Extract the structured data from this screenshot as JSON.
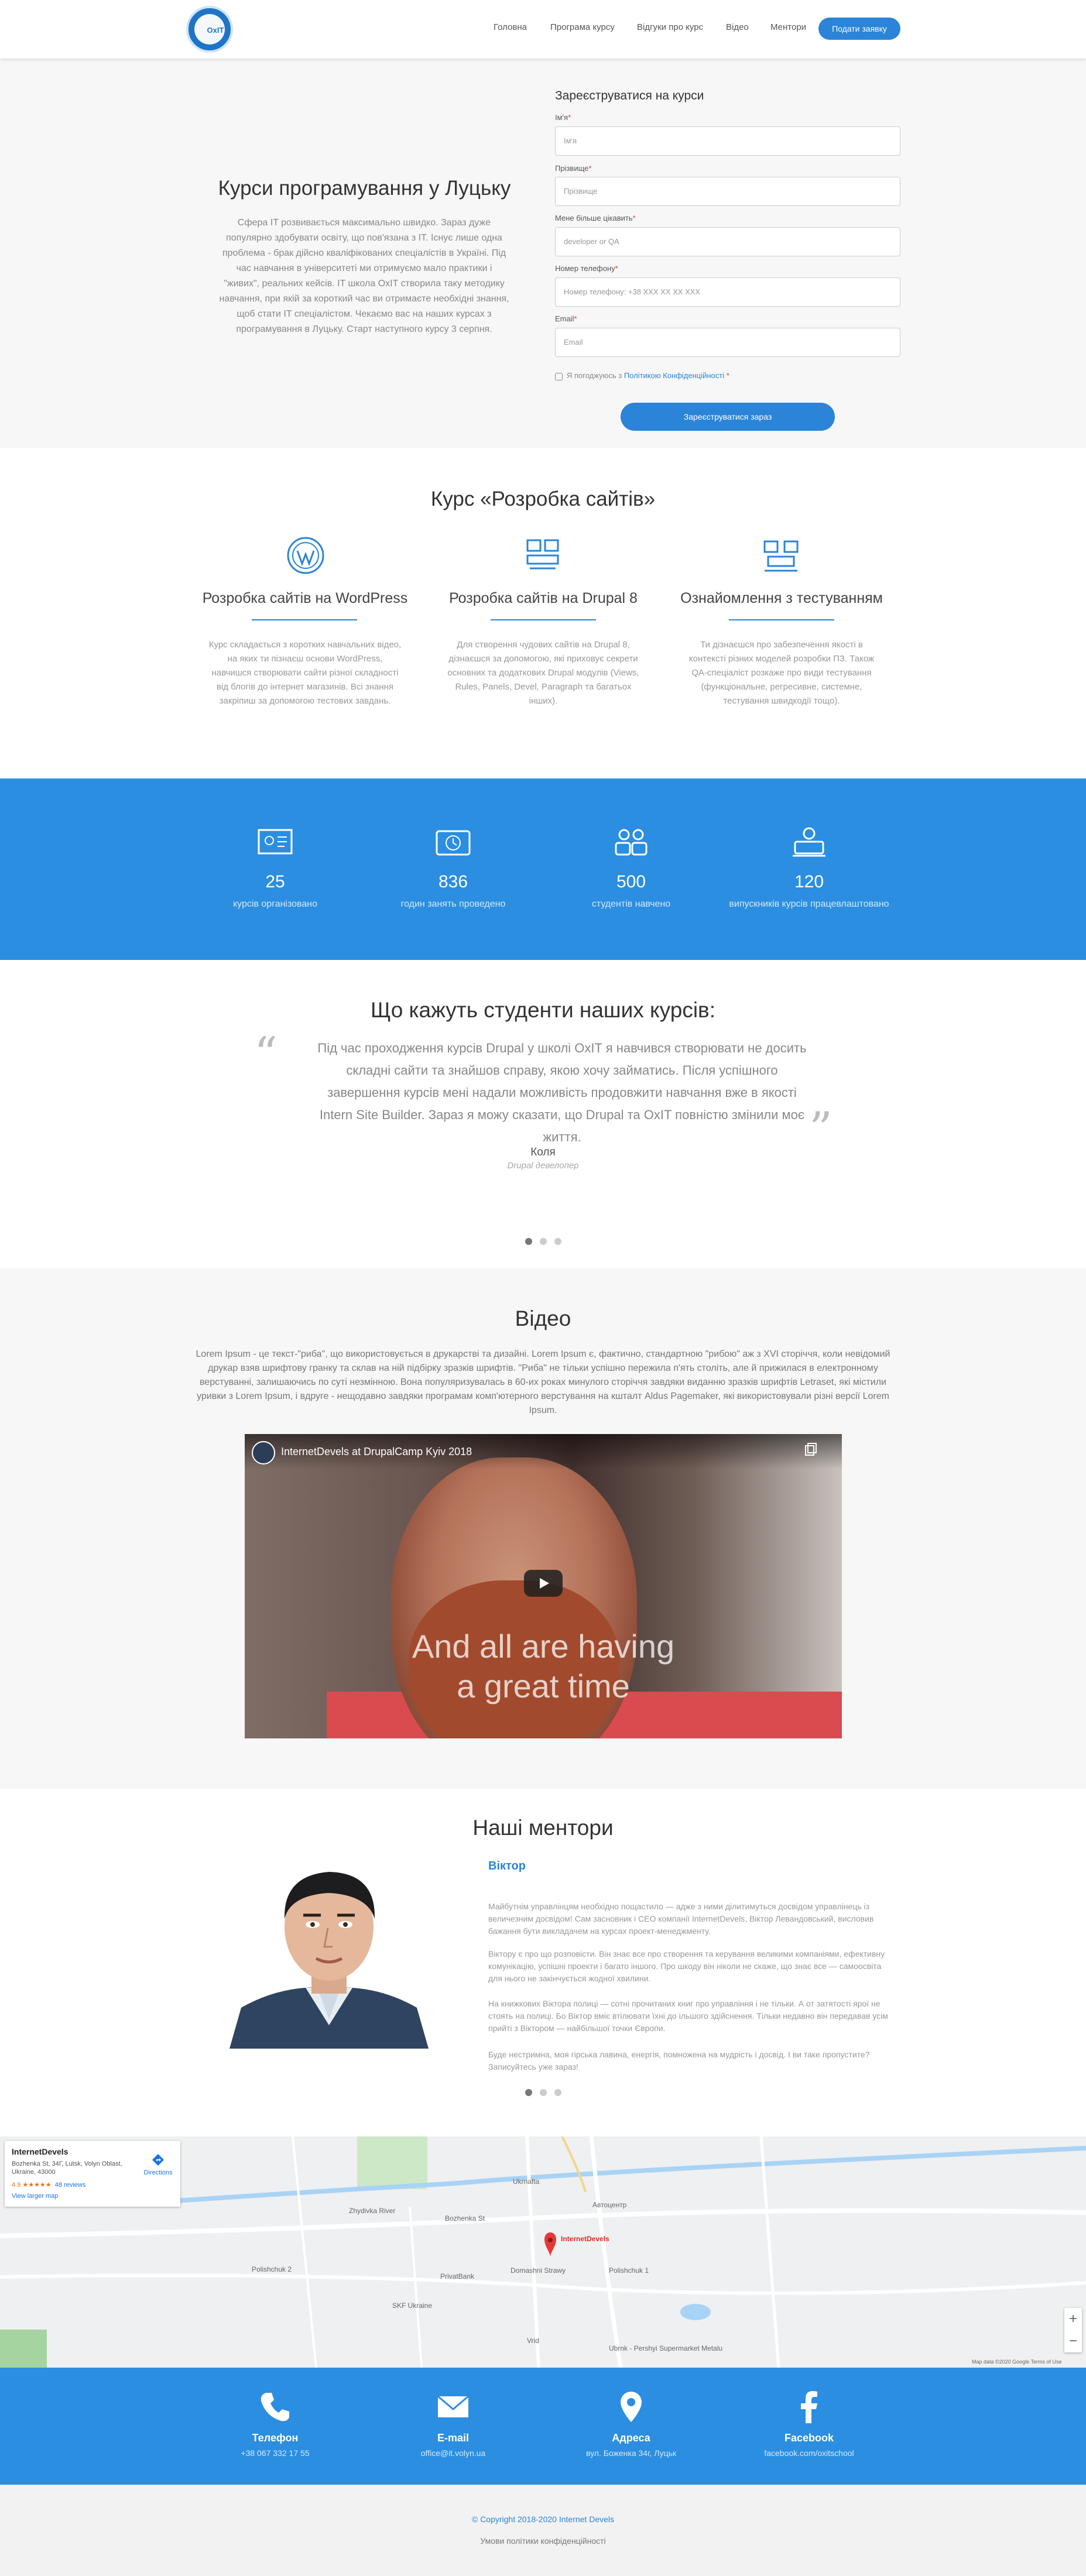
{
  "header": {
    "logo_text": "OxIT",
    "nav": [
      "Головна",
      "Програма курсу",
      "Відгуки про курс",
      "Відео",
      "Ментори"
    ],
    "cta": "Подати заявку"
  },
  "hero": {
    "title": "Курси програмування у Луцьку",
    "text": "Сфера IT розвивається максимально швидко. Зараз дуже популярно здобувати освіту, що пов'язана з IT. Існує лише одна проблема - брак дійсно кваліфікованих спеціалістів в Україні. Під час навчання в університеті ми отримуємо мало практики і \"живих\", реальних кейсів. IT школа OxIT створила таку методику навчання, при якій за короткий час ви отримаєте необхідні знання, щоб стати IT спеціалістом. Чекаємо вас на наших курсах з програмування в Луцьку. Старт наступного курсу 3 серпня."
  },
  "form": {
    "title": "Зареєструватися на курси",
    "fields": [
      {
        "label": "Ім'я",
        "placeholder": "Ім'я"
      },
      {
        "label": "Прізвище",
        "placeholder": "Прізвище"
      },
      {
        "label": "Мене більше цікавить",
        "placeholder": "developer or QA"
      },
      {
        "label": "Номер телефону",
        "placeholder": "Номер телефону: +38 XXX XX XX XXX"
      },
      {
        "label": "Email",
        "placeholder": "Email"
      }
    ],
    "required_mark": "*",
    "consent_prefix": "Я погоджуюсь з ",
    "consent_link": "Політикою Конфіденційності",
    "submit": "Зареєструватися зараз"
  },
  "course": {
    "title": "Курс «Розробка сайтів»",
    "features": [
      {
        "icon": "wordpress-icon",
        "title": "Розробка сайтів на WordPress",
        "text": "Курс складається з коротких навчальних відео, на яких ти пізнаєш основи WordPress, навчишся створювати сайти різної складності від блогів до інтернет магазинів. Всі знання закріпиш за допомогою тестових завдань."
      },
      {
        "icon": "drupal-icon",
        "title": "Розробка сайтів на Drupal 8",
        "text": "Для створення чудових сайтів на Drupal 8, дізнаєшся за допомогою, які приховує секрети основних та додаткових Drupal модулів (Views, Rules, Panels, Devel, Paragraph та багатьох інших)."
      },
      {
        "icon": "testing-icon",
        "title": "Ознайомлення з тестуванням",
        "text": "Ти дізнаєшся про забезпечення якості в контексті різних моделей розробки ПЗ. Також QA-спеціаліст розкаже про види тестування (функціональне, регресивне, системне, тестування швидкодії тощо)."
      }
    ]
  },
  "stats": [
    {
      "icon": "certificate-icon",
      "value": "25",
      "label": "курсів організовано"
    },
    {
      "icon": "clock-icon",
      "value": "836",
      "label": "годин занять проведено"
    },
    {
      "icon": "students-icon",
      "value": "500",
      "label": "студентів навчено"
    },
    {
      "icon": "employee-icon",
      "value": "120",
      "label": "випускників курсів працевлаштовано"
    }
  ],
  "testimonials": {
    "title": "Що кажуть студенти наших курсів:",
    "text": "Під час проходження курсів Drupal у школі OxIT я навчився створювати не досить складні сайти та знайшов справу, якою хочу займатись. Після успішного завершення курсів мені надали можливість продовжити навчання вже в якості Intern Site Builder. Зараз я можу сказати, що Drupal та OxIT повністю змінили моє життя.",
    "author": "Коля",
    "role": "Drupal девелопер",
    "active_slide": 1
  },
  "video": {
    "title": "Відео",
    "text": "Lorem Ipsum - це текст-\"риба\", що використовується в друкарстві та дизайні. Lorem Ipsum є, фактично, стандартною \"рибою\" аж з XVI сторіччя, коли невідомий друкар взяв шрифтову гранку та склав на ній підбірку зразків шрифтів. \"Риба\" не тільки успішно пережила п'ять століть, але й прижилася в електронному верстуванні, залишаючись по суті незмінною. Вона популяризувалась в 60-их роках минулого сторіччя завдяки виданню зразків шрифтів Letraset, які містили уривки з Lorem Ipsum, і вдруге - нещодавно завдяки програмам комп'ютерного верстування на кшталт Aldus Pagemaker, які використовували різні версії Lorem Ipsum.",
    "player_title": "InternetDevels at DrupalCamp Kyiv 2018",
    "caption_line1": "And all are having",
    "caption_line2": "a great time"
  },
  "mentors": {
    "title": "Наші ментори",
    "name": "Віктор",
    "paragraphs": [
      "Майбутнім управлінцям необхідно пощастило — адже з ними ділитимуться досвідом управлінець із величезним досвідом! Сам засновник і CEO компанії InternetDevels, Віктор Левандовський, висловив бажання бути викладачем на курсах проект-менеджменту.",
      "Віктору є про що розповісти. Він знає все про створення та керування великими компаніями, ефективну комунікацію, успішні проекти і багато іншого. Про шкоду він ніколи не скаже, що знає все — самоосвіта для нього не закінчується жодної хвилини.",
      "На книжкових Віктора полиці — сотні прочитаних книг про управління і не тільки. А от затятості ярої не стоять на полиці. Бо Віктор вміє втілювати їхні до ільшого здійснення. Тільки недавно він передавав усім прийті з Віктором — найбільшої точки Європи.",
      "Буде нестримна, моя гірська лавина, енергія, помножена на мудрість і досвід. І ви таке пропустите? Записуйтесь уже зараз!"
    ],
    "active_slide": 1
  },
  "map": {
    "place_name": "InternetDevels",
    "address": "Bozhenka St, 34Г, Lutsk, Volyn Oblast, Ukraine, 43000",
    "rating": "4.9 ★★★★★",
    "reviews": "48 reviews",
    "larger_map": "View larger map",
    "directions": "Directions",
    "marker_label": "InternetDevels",
    "labels": [
      "Zhydivka River",
      "Bozhenka St",
      "Автоцентр",
      "Domashni Strawy",
      "Polishchuk 2",
      "PrivatBank",
      "SKF Ukraine",
      "Polishchuk 1",
      "Ukrnafta",
      "Vrid",
      "Ubrnk - Pershyi Supermarket Metalu"
    ],
    "footer": "Map data ©2020 Google   Terms of Use"
  },
  "contacts": [
    {
      "icon": "phone-icon",
      "title": "Телефон",
      "value": "+38 067 332 17 55"
    },
    {
      "icon": "email-icon",
      "title": "E-mail",
      "value": "office@it.volyn.ua"
    },
    {
      "icon": "location-icon",
      "title": "Адреса",
      "value": "вул. Боженка 34г, Луцьк"
    },
    {
      "icon": "facebook-icon",
      "title": "Facebook",
      "value": "facebook.com/oxitschool"
    }
  ],
  "footer": {
    "copyright": "© Copyright 2018-2020 Internet Devels",
    "privacy": "Умови політики конфіденційності"
  },
  "colors": {
    "accent": "#2b84d8",
    "section_blue": "#2b8ee0",
    "light_bg": "#f7f7f7"
  }
}
